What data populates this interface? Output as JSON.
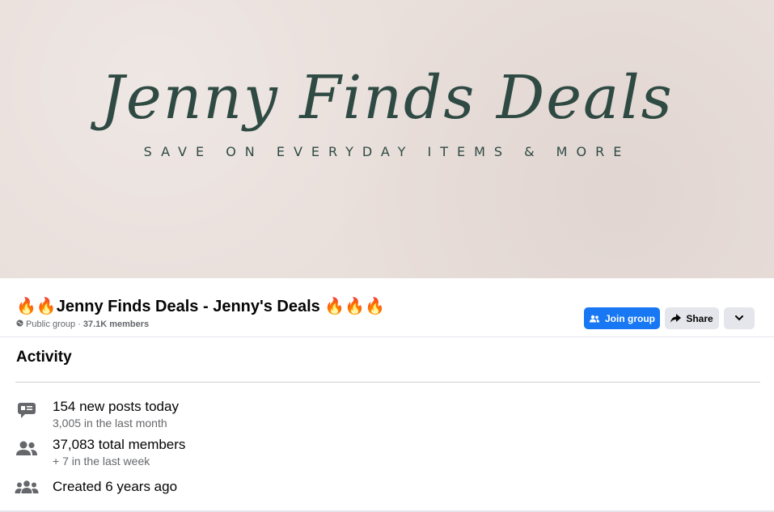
{
  "cover": {
    "title": "Jenny Finds Deals",
    "tagline": "SAVE ON EVERYDAY ITEMS & MORE",
    "background": "#e9dfdb",
    "text_color": "#2f4a43"
  },
  "group": {
    "title": "🔥🔥Jenny Finds Deals - Jenny's Deals 🔥🔥🔥",
    "privacy": "Public group",
    "separator": "·",
    "members": "37.1K members"
  },
  "actions": {
    "join_label": "Join group",
    "share_label": "Share",
    "more_icon": "chevron-down-icon",
    "accent": "#1877f2"
  },
  "activity": {
    "title": "Activity",
    "items": [
      {
        "icon": "chat-bubble-icon",
        "main": "154 new posts today",
        "sub": "3,005 in the last month"
      },
      {
        "icon": "members-icon",
        "main": "37,083 total members",
        "sub": "+ 7 in the last week"
      },
      {
        "icon": "group-icon",
        "main": "Created 6 years ago",
        "sub": ""
      }
    ]
  }
}
